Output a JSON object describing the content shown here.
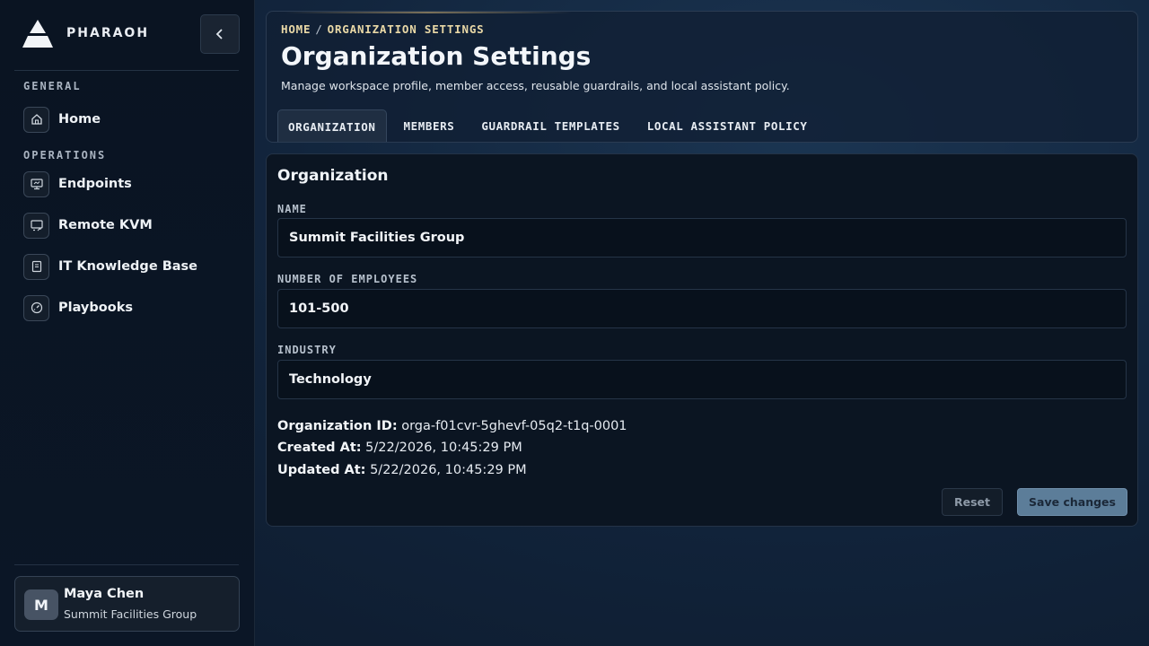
{
  "brand": {
    "name": "PHARAOH",
    "logo_icon": "pyramid-logo"
  },
  "sidebar": {
    "collapse_icon": "chevron-left-icon",
    "sections": [
      {
        "label": "GENERAL",
        "items": [
          {
            "label": "Home",
            "icon": "home-icon"
          }
        ]
      },
      {
        "label": "OPERATIONS",
        "items": [
          {
            "label": "Endpoints",
            "icon": "monitor-icon"
          },
          {
            "label": "Remote KVM",
            "icon": "remote-screen-icon"
          },
          {
            "label": "IT Knowledge Base",
            "icon": "book-icon"
          },
          {
            "label": "Playbooks",
            "icon": "gauge-icon"
          }
        ]
      }
    ]
  },
  "user": {
    "initial": "M",
    "name": "Maya Chen",
    "org": "Summit Facilities Group"
  },
  "header": {
    "breadcrumb": {
      "home": "HOME",
      "separator": "/",
      "current": "ORGANIZATION SETTINGS"
    },
    "title": "Organization Settings",
    "subtitle": "Manage workspace profile, member access, reusable guardrails, and local assistant policy.",
    "tabs": [
      {
        "label": "ORGANIZATION",
        "active": true
      },
      {
        "label": "MEMBERS",
        "active": false
      },
      {
        "label": "GUARDRAIL TEMPLATES",
        "active": false
      },
      {
        "label": "LOCAL ASSISTANT POLICY",
        "active": false
      }
    ]
  },
  "organization": {
    "card_title": "Organization",
    "fields": [
      {
        "label": "NAME",
        "value": "Summit Facilities Group"
      },
      {
        "label": "NUMBER OF EMPLOYEES",
        "value": "101-500"
      },
      {
        "label": "INDUSTRY",
        "value": "Technology"
      }
    ],
    "meta": [
      {
        "label": "Organization ID:",
        "value": "orga-f01cvr-5ghevf-05q2-t1q-0001"
      },
      {
        "label": "Created At:",
        "value": "5/22/2026, 10:45:29 PM"
      },
      {
        "label": "Updated At:",
        "value": "5/22/2026, 10:45:29 PM"
      }
    ],
    "reset_label": "Reset",
    "save_label": "Save changes"
  },
  "colors": {
    "accent": "#e9d8a6",
    "save_button": "#5c7d99",
    "background": "#12253d"
  }
}
